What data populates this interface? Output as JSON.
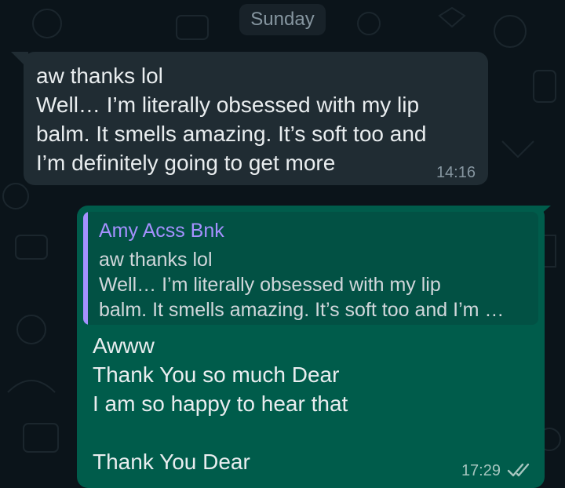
{
  "chat": {
    "date_separator": "Sunday",
    "incoming_message": {
      "text": "aw thanks lol\nWell… I’m literally obsessed with my lip\nbalm. It smells amazing. It’s soft too and\nI’m definitely going to get more",
      "time": "14:16"
    },
    "outgoing_message": {
      "quoted_author": "Amy Acss Bnk",
      "quoted_text": "aw thanks lol\nWell… I’m literally obsessed with my lip\nbalm. It smells amazing. It’s soft too and I’m …",
      "text": "Awww\nThank You so much Dear\nI am so happy to hear that\n\nThank You Dear",
      "time": "17:29",
      "status_icon": "double-check-icon"
    }
  },
  "colors": {
    "background": "#0b141a",
    "incoming_bubble": "#202c33",
    "outgoing_bubble": "#005c4b",
    "quote_accent": "#a591ff"
  }
}
